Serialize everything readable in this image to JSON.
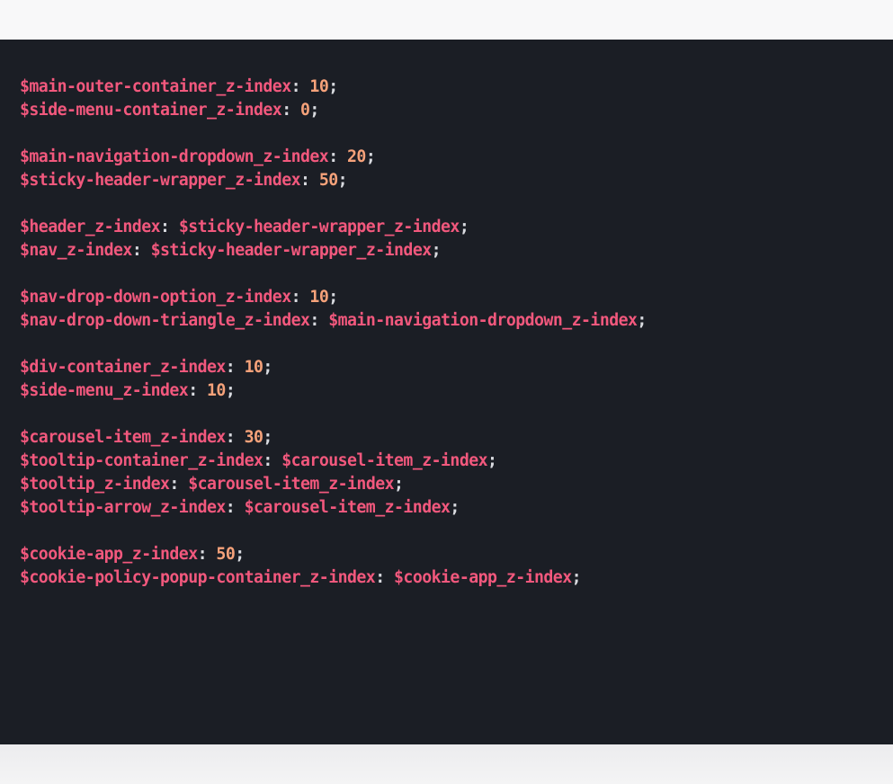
{
  "code_block": {
    "lines": [
      {
        "name": "$main-outer-container_z-index",
        "value": "10",
        "value_type": "number"
      },
      {
        "name": "$side-menu-container_z-index",
        "value": "0",
        "value_type": "number"
      },
      null,
      {
        "name": "$main-navigation-dropdown_z-index",
        "value": "20",
        "value_type": "number"
      },
      {
        "name": "$sticky-header-wrapper_z-index",
        "value": "50",
        "value_type": "number"
      },
      null,
      {
        "name": "$header_z-index",
        "value": "$sticky-header-wrapper_z-index",
        "value_type": "variable"
      },
      {
        "name": "$nav_z-index",
        "value": "$sticky-header-wrapper_z-index",
        "value_type": "variable"
      },
      null,
      {
        "name": "$nav-drop-down-option_z-index",
        "value": "10",
        "value_type": "number"
      },
      {
        "name": "$nav-drop-down-triangle_z-index",
        "value": "$main-navigation-dropdown_z-index",
        "value_type": "variable"
      },
      null,
      {
        "name": "$div-container_z-index",
        "value": "10",
        "value_type": "number"
      },
      {
        "name": "$side-menu_z-index",
        "value": "10",
        "value_type": "number"
      },
      null,
      {
        "name": "$carousel-item_z-index",
        "value": "30",
        "value_type": "number"
      },
      {
        "name": "$tooltip-container_z-index",
        "value": "$carousel-item_z-index",
        "value_type": "variable"
      },
      {
        "name": "$tooltip_z-index",
        "value": "$carousel-item_z-index",
        "value_type": "variable"
      },
      {
        "name": "$tooltip-arrow_z-index",
        "value": "$carousel-item_z-index",
        "value_type": "variable"
      },
      null,
      {
        "name": "$cookie-app_z-index",
        "value": "50",
        "value_type": "number"
      },
      {
        "name": "$cookie-policy-popup-container_z-index",
        "value": "$cookie-app_z-index",
        "value_type": "variable"
      }
    ]
  },
  "syntax_colors": {
    "background": "#1b1e25",
    "variable": "#f2587d",
    "number": "#f6a27a",
    "punctuation": "#d9dbe0"
  }
}
